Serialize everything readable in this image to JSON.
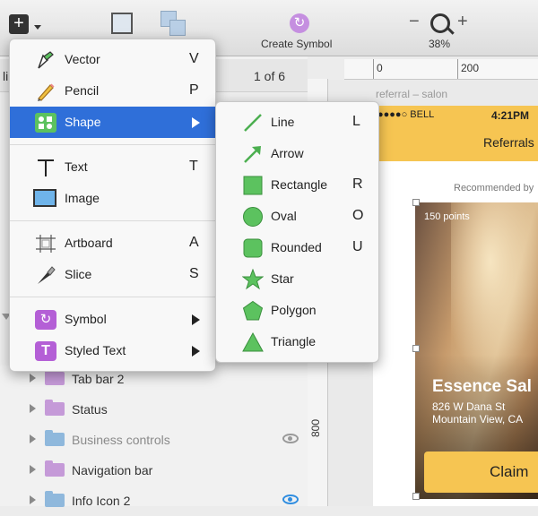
{
  "toolbar": {
    "create_symbol": "Create Symbol",
    "zoom_minus": "−",
    "zoom_plus": "+",
    "zoom_level": "38%"
  },
  "pagination": "1 of 6",
  "left_header_fragment": "li",
  "ruler": {
    "h_ticks": [
      "0",
      "200"
    ],
    "v_ticks": [
      "800"
    ]
  },
  "insert_menu": {
    "items": [
      {
        "label": "Vector",
        "shortcut": "V"
      },
      {
        "label": "Pencil",
        "shortcut": "P"
      },
      {
        "label": "Shape",
        "shortcut": ""
      },
      {
        "label": "Text",
        "shortcut": "T"
      },
      {
        "label": "Image",
        "shortcut": ""
      },
      {
        "label": "Artboard",
        "shortcut": "A"
      },
      {
        "label": "Slice",
        "shortcut": "S"
      },
      {
        "label": "Symbol",
        "shortcut": ""
      },
      {
        "label": "Styled Text",
        "shortcut": ""
      }
    ]
  },
  "shape_submenu": {
    "items": [
      {
        "label": "Line",
        "shortcut": "L"
      },
      {
        "label": "Arrow",
        "shortcut": ""
      },
      {
        "label": "Rectangle",
        "shortcut": "R"
      },
      {
        "label": "Oval",
        "shortcut": "O"
      },
      {
        "label": "Rounded",
        "shortcut": "U"
      },
      {
        "label": "Star",
        "shortcut": ""
      },
      {
        "label": "Polygon",
        "shortcut": ""
      },
      {
        "label": "Triangle",
        "shortcut": ""
      }
    ]
  },
  "layers": [
    {
      "label": "Tab bar 2",
      "color": "#c59ad8",
      "eye": false
    },
    {
      "label": "Status",
      "color": "#c59ad8",
      "eye": false
    },
    {
      "label": "Business controls",
      "color": "#8fb8dc",
      "eye": true,
      "muted": true
    },
    {
      "label": "Navigation bar",
      "color": "#c59ad8",
      "eye": false
    },
    {
      "label": "Info Icon 2",
      "color": "#8fb8dc",
      "eye": true
    }
  ],
  "artboard": {
    "title": "referral – salon",
    "carrier": "●●●●○ BELL",
    "time": "4:21PM",
    "nav_title": "Referrals",
    "recommended": "Recommended by",
    "points": "150 points",
    "business": "Essence Sal",
    "address1": "826 W Dana St",
    "address2": "Mountain View, CA",
    "claim": "Claim"
  },
  "colors": {
    "highlight": "#2f6fd9",
    "green": "#5cc25f",
    "brand_yellow": "#f6c552",
    "purple": "#b45fd6"
  }
}
